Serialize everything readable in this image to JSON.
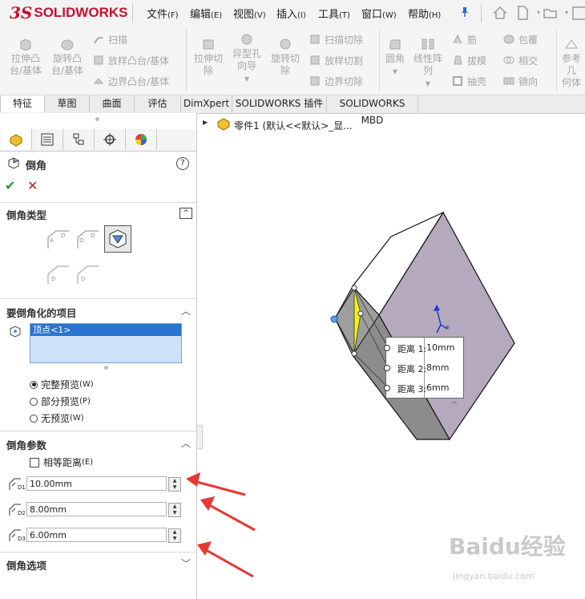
{
  "app": {
    "brand": "SOLIDWORKS",
    "brand_prefix": "3S"
  },
  "menus": [
    {
      "label": "文件",
      "key": "(F)"
    },
    {
      "label": "编辑",
      "key": "(E)"
    },
    {
      "label": "视图",
      "key": "(V)"
    },
    {
      "label": "插入",
      "key": "(I)"
    },
    {
      "label": "工具",
      "key": "(T)"
    },
    {
      "label": "窗口",
      "key": "(W)"
    },
    {
      "label": "帮助",
      "key": "(H)"
    }
  ],
  "ribbon": {
    "extrude_boss": [
      "拉伸凸",
      "台/基体"
    ],
    "revolve_boss": [
      "旋转凸",
      "台/基体"
    ],
    "sweep": "扫描",
    "loft_boss": "放样凸台/基体",
    "boundary_boss": "边界凸台/基体",
    "extrude_cut": [
      "拉伸切",
      "除"
    ],
    "hole_wizard": [
      "异型孔",
      "向导"
    ],
    "revolve_cut": [
      "旋转切",
      "除"
    ],
    "sweep_cut": "扫描切除",
    "loft_cut": "放样切割",
    "boundary_cut": "边界切除",
    "fillet": "圆角",
    "linear_pattern": [
      "线性阵",
      "列"
    ],
    "rib": "筋",
    "draft": "拔模",
    "shell": "抽壳",
    "wrap": "包覆",
    "intersect": "相交",
    "mirror": "镜向",
    "reference_geometry": [
      "参考几",
      "何体"
    ]
  },
  "tabs": [
    "特征",
    "草图",
    "曲面",
    "评估",
    "DimXpert",
    "SOLIDWORKS 插件",
    "SOLIDWORKS MBD"
  ],
  "tree": {
    "part_label": "零件1  (默认<<默认>_显..."
  },
  "panel": {
    "title": "倒角",
    "help": "?",
    "ok": "✔",
    "cancel": "✕",
    "type_section": "倒角类型",
    "items_section": "要倒角化的项目",
    "selected_item": "顶点<1>",
    "preview_options": [
      {
        "label": "完整预览",
        "key": "(W)",
        "selected": true
      },
      {
        "label": "部分预览",
        "key": "(P)",
        "selected": false
      },
      {
        "label": "无预览",
        "key": "(W)",
        "selected": false
      }
    ],
    "params_section": "倒角参数",
    "equal_distance": "相等距离",
    "equal_distance_key": "(E)",
    "equal_distance_checked": false,
    "d1_value": "10.00mm",
    "d2_value": "8.00mm",
    "d3_value": "6.00mm",
    "d1_label": "D1",
    "d2_label": "D2",
    "d3_label": "D3",
    "options_section": "倒角选项"
  },
  "callout": {
    "rows": [
      {
        "label": "距离 1:",
        "value": "10mm"
      },
      {
        "label": "距离 2:",
        "value": "8mm"
      },
      {
        "label": "距离 3:",
        "value": "6mm"
      }
    ]
  },
  "watermark": {
    "main": "Baidu经验",
    "sub": "jingyan.baidu.com"
  },
  "colors": {
    "brand": "#c8102e",
    "arrow": "#e53935",
    "selection": "#2b74d0",
    "face_dark": "#8c8c8c",
    "face_light": "#b4a9bd",
    "highlight": "#f5f500"
  }
}
